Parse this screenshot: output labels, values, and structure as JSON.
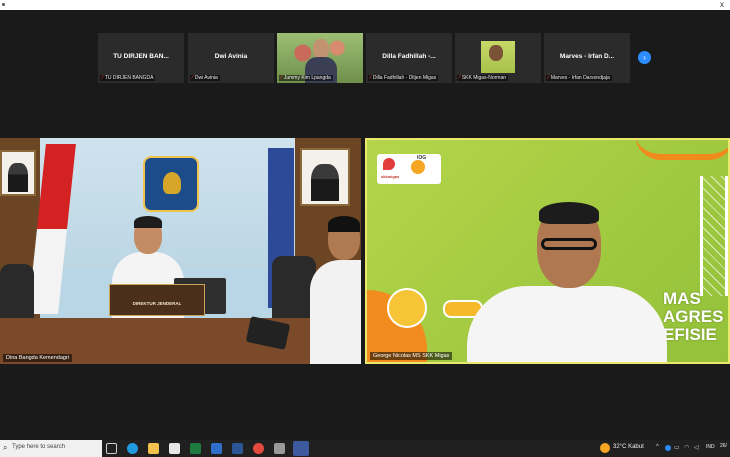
{
  "window": {
    "close_glyph": "x"
  },
  "thumbnails": [
    {
      "name": "TU DIRJEN BAN...",
      "label": "TU DIRJEN BANGDA",
      "has_video": false
    },
    {
      "name": "Dwi Avinia",
      "label": "Dwi Avinia",
      "has_video": false
    },
    {
      "name": "",
      "label": "Jummy Kim Lpangda",
      "has_video": true
    },
    {
      "name": "Dilla Fadhillah -...",
      "label": "Dilla Fadhillah - Ditjen Migas",
      "has_video": false
    },
    {
      "name": "",
      "label": "SKK Migas-Norman",
      "has_video": true
    },
    {
      "name": "Marves - Irfan D...",
      "label": "Marves - Irfan Darsondjaja",
      "has_video": false
    }
  ],
  "next_button_glyph": "›",
  "tiles": {
    "left": {
      "label": "Dina Bangda Kemendagri",
      "nameplate": "DIREKTUR JENDERAL"
    },
    "right": {
      "label": "George Nicolas MS SKK Migas",
      "logo_left": "skkmigas",
      "logo_right": "IOG",
      "slide_text_lines": [
        "MAS",
        "AGRES",
        "EFISIE"
      ]
    }
  },
  "taskbar": {
    "search_icon": "search-icon",
    "search_placeholder": "Type here to search",
    "weather": "32°C Kabut",
    "language": "IND",
    "clock": "26/"
  },
  "colors": {
    "zoom_blue": "#2d8cff",
    "active_speaker_border": "#e9e86b",
    "mic_muted": "#e23b3b"
  }
}
